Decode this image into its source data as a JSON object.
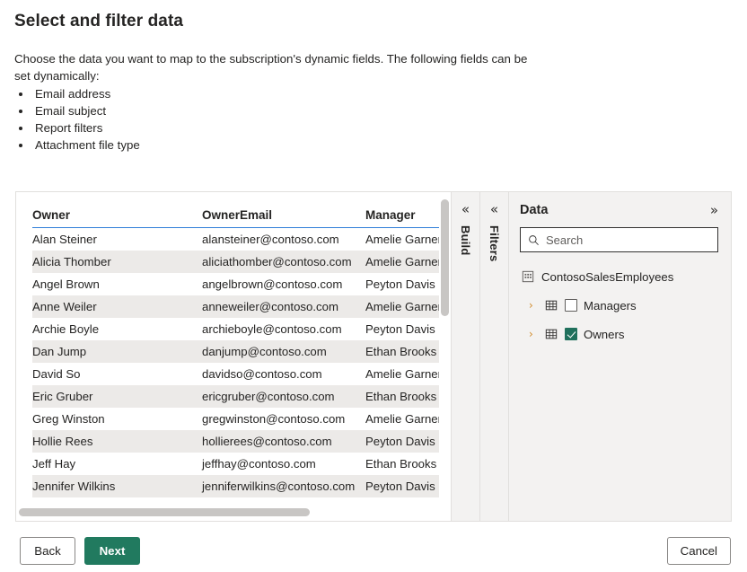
{
  "page": {
    "title": "Select and filter data",
    "intro": "Choose the data you want to map to the subscription's dynamic fields. The following fields can be set dynamically:",
    "bullets": [
      "Email address",
      "Email subject",
      "Report filters",
      "Attachment file type"
    ]
  },
  "table": {
    "columns": [
      "Owner",
      "OwnerEmail",
      "Manager"
    ],
    "rows": [
      [
        "Alan Steiner",
        "alansteiner@contoso.com",
        "Amelie Garner"
      ],
      [
        "Alicia Thomber",
        "aliciathomber@contoso.com",
        "Amelie Garner"
      ],
      [
        "Angel Brown",
        "angelbrown@contoso.com",
        "Peyton Davis"
      ],
      [
        "Anne Weiler",
        "anneweiler@contoso.com",
        "Amelie Garner"
      ],
      [
        "Archie Boyle",
        "archieboyle@contoso.com",
        "Peyton Davis"
      ],
      [
        "Dan Jump",
        "danjump@contoso.com",
        "Ethan Brooks"
      ],
      [
        "David So",
        "davidso@contoso.com",
        "Amelie Garner"
      ],
      [
        "Eric Gruber",
        "ericgruber@contoso.com",
        "Ethan Brooks"
      ],
      [
        "Greg Winston",
        "gregwinston@contoso.com",
        "Amelie Garner"
      ],
      [
        "Hollie Rees",
        "hollierees@contoso.com",
        "Peyton Davis"
      ],
      [
        "Jeff Hay",
        "jeffhay@contoso.com",
        "Ethan Brooks"
      ],
      [
        "Jennifer Wilkins",
        "jenniferwilkins@contoso.com",
        "Peyton Davis"
      ]
    ]
  },
  "rails": {
    "build": {
      "label": "Build",
      "collapse_icon": "«"
    },
    "filters": {
      "label": "Filters",
      "collapse_icon": "«"
    }
  },
  "data_pane": {
    "title": "Data",
    "expand_icon": "»",
    "search": {
      "placeholder": "Search",
      "value": ""
    },
    "dataset": {
      "label": "ContosoSalesEmployees"
    },
    "tables": [
      {
        "label": "Managers",
        "checked": false,
        "expander": "›"
      },
      {
        "label": "Owners",
        "checked": true,
        "expander": "›"
      }
    ]
  },
  "footer": {
    "back_label": "Back",
    "next_label": "Next",
    "cancel_label": "Cancel"
  },
  "colors": {
    "primary": "#217a5f",
    "checkbox_checked": "#20705c",
    "header_underline": "#2f7ed8",
    "expander": "#d08a2a",
    "panel_bg": "#f3f2f1",
    "row_alt": "#eceae8"
  }
}
